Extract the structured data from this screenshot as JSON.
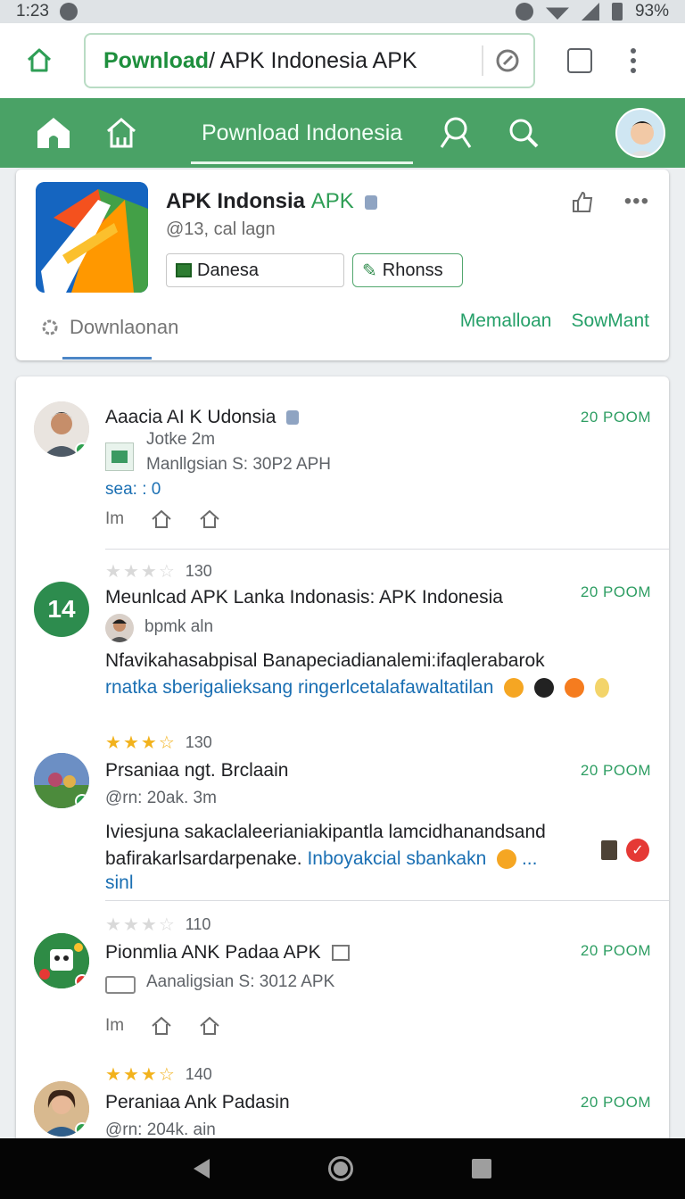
{
  "status": {
    "time": "1:23",
    "battery": "93%"
  },
  "browser": {
    "url_brand": "Pownload",
    "url_rest": "/ APK Indonesia APK"
  },
  "appbar": {
    "title": "Pownload Indonesia"
  },
  "app": {
    "name": "APK Indonsia",
    "name_suffix": "APK",
    "meta": "@13, cal lagn",
    "chip1": "Danesa",
    "chip2": "Rhonss",
    "tab": "Downlaonan",
    "link1": "Memalloan",
    "link2": "SowMant"
  },
  "feed": {
    "p1": {
      "name": "Aaacia AI K Udonsia",
      "time": "20 POOM",
      "line1": "Jotke 2m",
      "line2": "Manllgsian S: 30P2 APH",
      "seas": "sea: :  0",
      "action": "Im"
    },
    "p2": {
      "rating": "130",
      "name": "Meunlcad APK Lanka Indonasis: APK Indonesia",
      "time": "20 POOM",
      "avatar_label": "14",
      "sub": "bpmk aln",
      "body": "Nfavikahasabpisal Banapeciadianalemi:ifaqlerabarok",
      "body_link": "rnatka sberigalieksang ringerlcetalafawaltatilan"
    },
    "p3": {
      "rating": "130",
      "name": "Prsaniaa ngt. Brclaain",
      "time": "20 POOM",
      "sub": "@rn: 20ak. 3m",
      "body": "Iviesjuna sakaclaleerianiakipantla lamcidhanandsand bafirakarlsardarpenake.",
      "body_link": "Inboyakcial sbankakn",
      "more": "sinl"
    },
    "p4": {
      "rating": "110",
      "name": "Pionmlia ANK Padaa APK",
      "time": "20 POOM",
      "sub": "Aanaligsian S: 3012 APK",
      "action": "Im"
    },
    "p5": {
      "rating": "140",
      "name": "Peraniaa Ank Padasin",
      "time": "20 POOM",
      "sub": "@rn: 204k. ain"
    }
  },
  "colors": {
    "brand_green": "#4aa266",
    "link_blue": "#1a6fb3",
    "star": "#f2b21c"
  }
}
